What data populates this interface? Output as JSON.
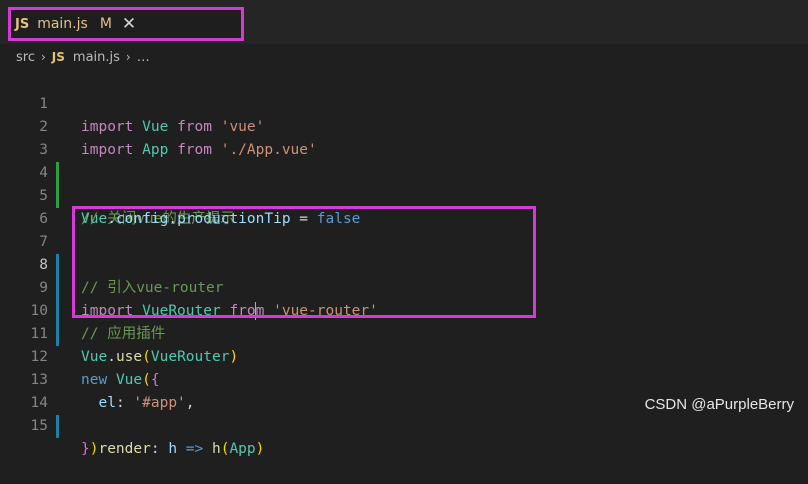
{
  "tab": {
    "badge": "JS",
    "title": "main.js",
    "modified": "M",
    "close": "✕"
  },
  "breadcrumb": {
    "folder": "src",
    "sep": "›",
    "badge": "JS",
    "file": "main.js",
    "more": "…"
  },
  "lines": [
    {
      "n": "1"
    },
    {
      "n": "2"
    },
    {
      "n": "3"
    },
    {
      "n": "4"
    },
    {
      "n": "5"
    },
    {
      "n": "6"
    },
    {
      "n": "7"
    },
    {
      "n": "8"
    },
    {
      "n": "9"
    },
    {
      "n": "10"
    },
    {
      "n": "11"
    },
    {
      "n": "12"
    },
    {
      "n": "13"
    },
    {
      "n": "14"
    },
    {
      "n": "15"
    }
  ],
  "code": {
    "l1": {
      "kw": "import",
      "id": "Vue",
      "from": "from",
      "str": "'vue'"
    },
    "l2": {
      "kw": "import",
      "id": "App",
      "from": "from",
      "str": "'./App.vue'"
    },
    "l4": {
      "comment": "// 关闭vue的生产提示"
    },
    "l5": {
      "obj": "Vue",
      "dot1": ".",
      "prop1": "config",
      "dot2": ".",
      "prop2": "productionTip",
      "eq": " = ",
      "val": "false"
    },
    "l7": {
      "comment": "// 引入vue-router"
    },
    "l8": {
      "kw": "import",
      "id": "VueRouter",
      "from_a": "fro",
      "from_b": "m",
      "str": "'vue-router'"
    },
    "l9": {
      "comment": "// 应用插件"
    },
    "l10": {
      "obj": "Vue",
      "dot": ".",
      "fn": "use",
      "open": "(",
      "arg": "VueRouter",
      "close": ")"
    },
    "l12": {
      "kw": "new",
      "id": "Vue",
      "open": "(",
      "brace": "{"
    },
    "l13": {
      "key": "el",
      "colon": ": ",
      "str": "'#app'",
      "comma": ","
    },
    "l14": {
      "key": "render",
      "colon": ": ",
      "param": "h",
      "arrow": " => ",
      "fn": "h",
      "open": "(",
      "arg": "App",
      "close": ")"
    },
    "l15": {
      "brace": "}",
      "close": ")"
    }
  },
  "watermark": "CSDN @aPurpleBerry",
  "colors": {
    "highlight": "#d63ad6",
    "background": "#1f1f1f"
  }
}
